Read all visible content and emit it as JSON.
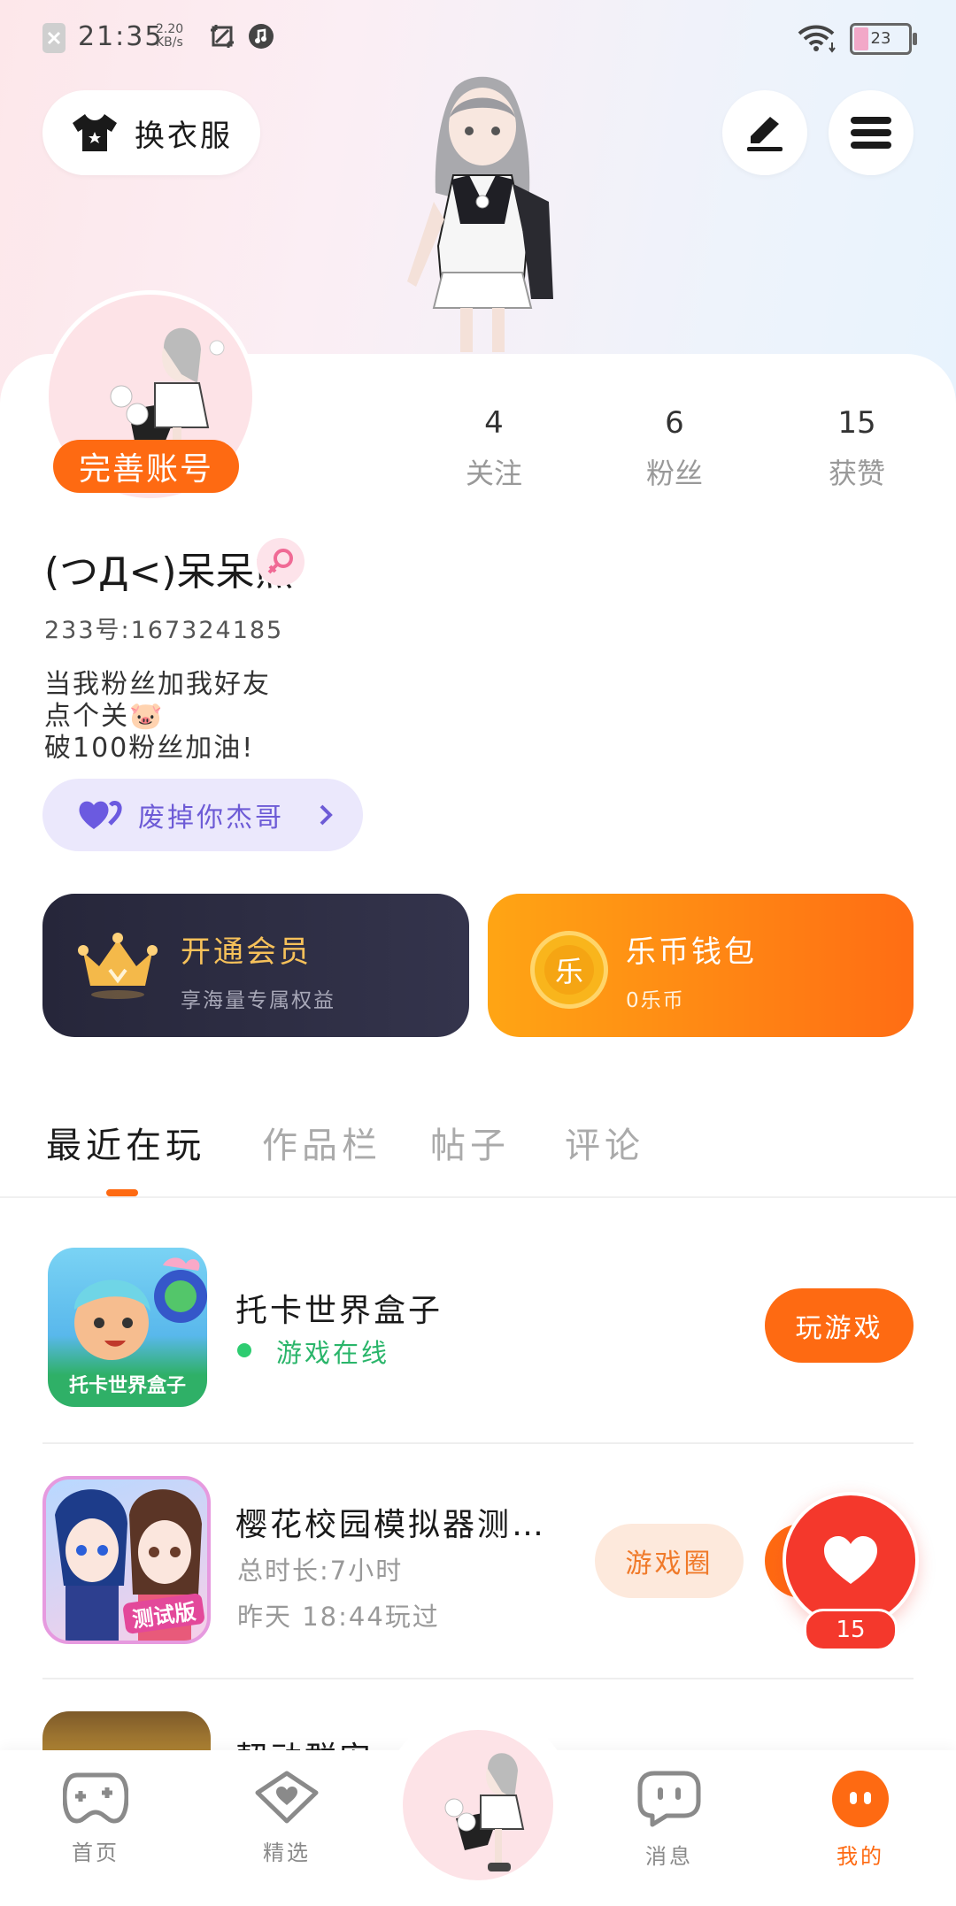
{
  "status_bar": {
    "time": "21:35",
    "speed_value": "2.20",
    "speed_unit": "KB/s",
    "battery": "23"
  },
  "header": {
    "dress_up_label": "换衣服"
  },
  "profile": {
    "complete_account_label": "完善账号",
    "stats": [
      {
        "value": "4",
        "label": "关注"
      },
      {
        "value": "6",
        "label": "粉丝"
      },
      {
        "value": "15",
        "label": "获赞"
      }
    ],
    "username": "(つД<)呆呆熊",
    "user_id": "233号:167324185",
    "bio_lines": [
      "当我粉丝加我好友",
      "点个关🐷",
      "破100粉丝加油!"
    ],
    "fan_badge_label": "废掉你杰哥"
  },
  "cards": {
    "vip": {
      "title": "开通会员",
      "subtitle": "享海量专属权益"
    },
    "wallet": {
      "title": "乐币钱包",
      "subtitle": "0乐币",
      "coin_char": "乐"
    }
  },
  "tabs": [
    "最近在玩",
    "作品栏",
    "帖子",
    "评论"
  ],
  "games": [
    {
      "name": "托卡世界盒子",
      "status": "游戏在线",
      "icon_text": "托卡世界盒子",
      "play_label": "玩游戏"
    },
    {
      "name": "樱花校园模拟器测…",
      "total_time": "总时长:7小时",
      "last_played": "昨天 18:44玩过",
      "icon_text": "测试版",
      "circle_label": "游戏圈"
    },
    {
      "name": "契动群安"
    }
  ],
  "like": {
    "count": "15"
  },
  "nav": [
    {
      "label": "首页"
    },
    {
      "label": "精选"
    },
    {
      "label": "消息"
    },
    {
      "label": "我的"
    }
  ],
  "colors": {
    "accent": "#fe6a12",
    "like_red": "#f4382c",
    "online_green": "#2ecc71",
    "fan_purple": "#6d5bd6"
  }
}
